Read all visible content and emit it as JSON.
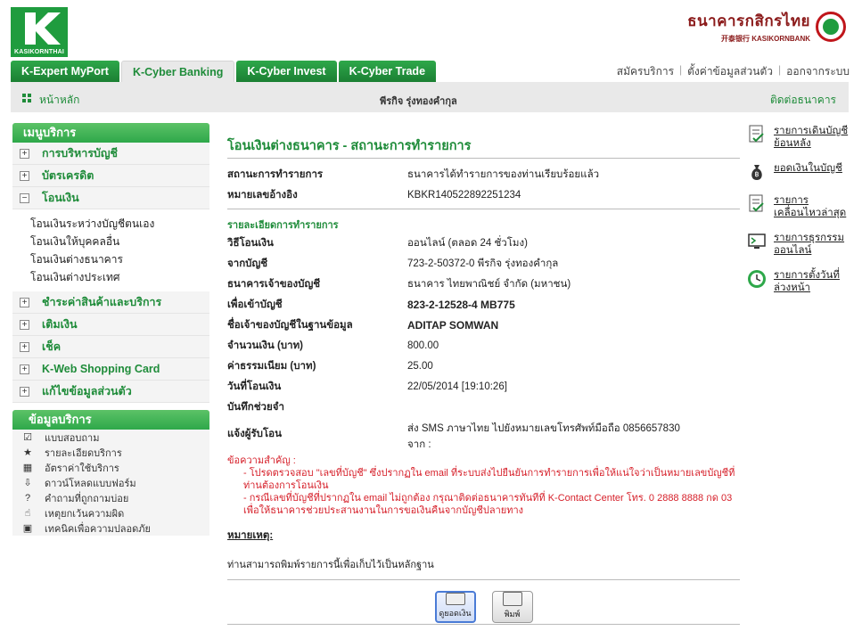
{
  "brand": {
    "logo_text": "KASIKORNTHAI",
    "bank_name_thai": "ธนาคารกสิกรไทย",
    "bank_name_en": "开泰银行 KASIKORNBANK"
  },
  "tabs": [
    {
      "label": "K-Expert MyPort"
    },
    {
      "label": "K-Cyber Banking"
    },
    {
      "label": "K-Cyber Invest"
    },
    {
      "label": "K-Cyber Trade"
    }
  ],
  "top_links": {
    "register": "สมัครบริการ",
    "settings": "ตั้งค่าข้อมูลส่วนตัว",
    "logout": "ออกจากระบบ"
  },
  "subbar": {
    "home": "หน้าหลัก",
    "user": "พีรกิจ รุ่งทองคำกุล",
    "contact": "ติดต่อธนาคาร"
  },
  "menu": {
    "title": "เมนูบริการ",
    "items": [
      {
        "label": "การบริหารบัญชี",
        "toggle": "+"
      },
      {
        "label": "บัตรเครดิต",
        "toggle": "+"
      },
      {
        "label": "โอนเงิน",
        "toggle": "−"
      }
    ],
    "sub_items": [
      {
        "label": "โอนเงินระหว่างบัญชีตนเอง"
      },
      {
        "label": "โอนเงินให้บุคคลอื่น"
      },
      {
        "label": "โอนเงินต่างธนาคาร"
      },
      {
        "label": "โอนเงินต่างประเทศ"
      }
    ],
    "items_after": [
      {
        "label": "ชำระค่าสินค้าและบริการ",
        "toggle": "+"
      },
      {
        "label": "เติมเงิน",
        "toggle": "+"
      },
      {
        "label": "เช็ค",
        "toggle": "+"
      },
      {
        "label": "K-Web Shopping Card",
        "toggle": "+"
      },
      {
        "label": "แก้ไขข้อมูลส่วนตัว",
        "toggle": "+"
      }
    ]
  },
  "info": {
    "title": "ข้อมูลบริการ",
    "items": [
      {
        "label": "แบบสอบถาม",
        "icon": "check-icon"
      },
      {
        "label": "รายละเอียดบริการ",
        "icon": "star-icon"
      },
      {
        "label": "อัตราค่าใช้บริการ",
        "icon": "calculator-icon"
      },
      {
        "label": "ดาวน์โหลดแบบฟอร์ม",
        "icon": "download-icon"
      },
      {
        "label": "คำถามที่ถูกถามบ่อย",
        "icon": "question-icon"
      },
      {
        "label": "เหตุยกเว้นความผิด",
        "icon": "hand-icon"
      },
      {
        "label": "เทคนิคเพื่อความปลอดภัย",
        "icon": "lock-icon"
      }
    ]
  },
  "main": {
    "title": "โอนเงินต่างธนาคาร - สถานะการทำรายการ",
    "status_label": "สถานะการทำรายการ",
    "status_value": "ธนาคารได้ทำรายการของท่านเรียบร้อยแล้ว",
    "ref_label": "หมายเลขอ้างอิง",
    "ref_value": "KBKR140522892251234",
    "detail_title": "รายละเอียดการทำรายการ",
    "method_label": "วิธีโอนเงิน",
    "method_value": "ออนไลน์ (ตลอด 24 ชั่วโมง)",
    "from_label": "จากบัญชี",
    "from_value": "723-2-50372-0 พีรกิจ รุ่งทองคำกุล",
    "bank_label": "ธนาคารเจ้าของบัญชี",
    "bank_value": "ธนาคาร ไทยพาณิชย์ จำกัด (มหาชน)",
    "to_label": "เพื่อเข้าบัญชี",
    "to_value": "823-2-12528-4 MB775",
    "owner_label": "ชื่อเจ้าของบัญชีในฐานข้อมูล",
    "owner_value": "ADITAP SOMWAN",
    "amount_label": "จำนวนเงิน (บาท)",
    "amount_value": "800.00",
    "fee_label": "ค่าธรรมเนียม (บาท)",
    "fee_value": "25.00",
    "date_label": "วันที่โอนเงิน",
    "date_value": "22/05/2014 [19:10:26]",
    "memo_label": "บันทึกช่วยจำ",
    "memo_value": "",
    "notify_label": "แจ้งผู้รับโอน",
    "notify_value_1": "ส่ง SMS ภาษาไทย ไปยังหมายเลขโทรศัพท์มือถือ 0856657830",
    "notify_value_2": "จาก :",
    "notice_head": "ข้อความสำคัญ :",
    "notice_1": "- โปรดตรวจสอบ \"เลขที่บัญชี\" ซึ่งปรากฏใน email ที่ระบบส่งไปยืนยันการทำรายการเพื่อให้แน่ใจว่าเป็นหมายเลขบัญชีที่ท่านต้องการโอนเงิน",
    "notice_2": "- กรณีเลขที่บัญชีที่ปรากฏใน email ไม่ถูกต้อง กรุณาติดต่อธนาคารทันทีที่ K-Contact Center โทร. 0 2888 8888 กด 03 เพื่อให้ธนาคารช่วยประสานงานในการขอเงินคืนจากบัญชีปลายทาง",
    "note_head": "หมายเหตุ:",
    "note_text": "ท่านสามารถพิมพ์รายการนี้เพื่อเก็บไว้เป็นหลักฐาน",
    "btn_view": "ดูยอดเงิน",
    "btn_print": "พิมพ์"
  },
  "right_links": [
    {
      "label": "รายการเดินบัญชีย้อนหลัง",
      "icon": "statement-icon"
    },
    {
      "label": "ยอดเงินในบัญชี",
      "icon": "money-bag-icon"
    },
    {
      "label": "รายการเคลื่อนไหวล่าสุด",
      "icon": "checklist-icon"
    },
    {
      "label": "รายการธุรกรรมออนไลน์",
      "icon": "monitor-icon"
    },
    {
      "label": "รายการตั้งวันที่ล่วงหน้า",
      "icon": "clock-icon"
    }
  ]
}
